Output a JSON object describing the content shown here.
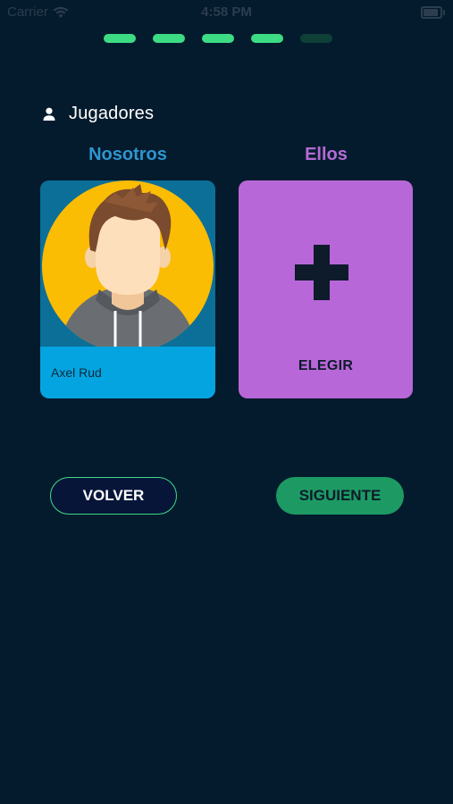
{
  "status_bar": {
    "carrier": "Carrier",
    "time": "4:58 PM"
  },
  "progress": {
    "total_steps": 5,
    "completed_steps": 4
  },
  "section": {
    "title": "Jugadores",
    "icon": "person-icon"
  },
  "teams": {
    "us_label": "Nosotros",
    "them_label": "Ellos"
  },
  "player_card": {
    "name": "Axel Rud"
  },
  "choose_card": {
    "label": "ELEGIR",
    "icon": "plus-icon"
  },
  "buttons": {
    "back_label": "VOLVER",
    "next_label": "SIGUIENTE"
  },
  "colors": {
    "background": "#041b2d",
    "accent_green": "#3ddc84",
    "us_blue": "#2f95cf",
    "them_purple": "#b46bd6",
    "card_blue": "#04a4e0",
    "card_purple": "#b867d8",
    "next_button": "#1d9a63"
  }
}
